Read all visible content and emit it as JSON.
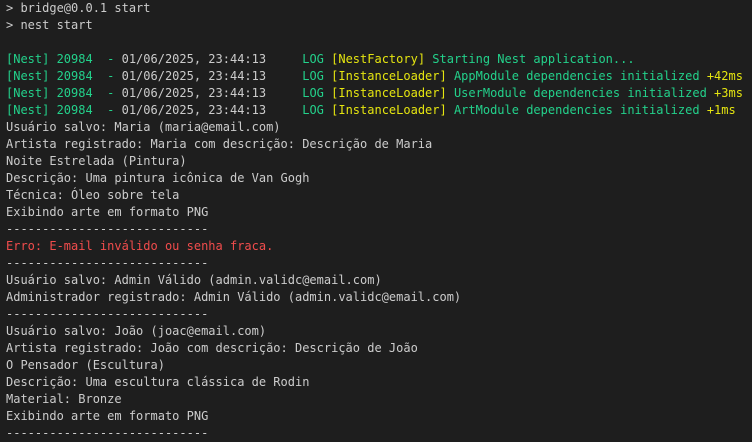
{
  "colors": {
    "background": "#1e1e1e",
    "foreground": "#cccccc",
    "green": "#23d18b",
    "yellow": "#e5e510",
    "red": "#f14c4c"
  },
  "lines": [
    {
      "kind": "plain",
      "text": "> bridge@0.0.1 start"
    },
    {
      "kind": "plain",
      "text": "> nest start"
    },
    {
      "kind": "blank",
      "text": ""
    },
    {
      "kind": "nest",
      "prefix": "[Nest] 20984  - ",
      "timestamp": "01/06/2025, 23:44:13",
      "level": "     LOG ",
      "context": "[NestFactory]",
      "message": " Starting Nest application...",
      "duration": ""
    },
    {
      "kind": "nest",
      "prefix": "[Nest] 20984  - ",
      "timestamp": "01/06/2025, 23:44:13",
      "level": "     LOG ",
      "context": "[InstanceLoader]",
      "message": " AppModule dependencies initialized",
      "duration": " +42ms"
    },
    {
      "kind": "nest",
      "prefix": "[Nest] 20984  - ",
      "timestamp": "01/06/2025, 23:44:13",
      "level": "     LOG ",
      "context": "[InstanceLoader]",
      "message": " UserModule dependencies initialized",
      "duration": " +3ms"
    },
    {
      "kind": "nest",
      "prefix": "[Nest] 20984  - ",
      "timestamp": "01/06/2025, 23:44:13",
      "level": "     LOG ",
      "context": "[InstanceLoader]",
      "message": " ArtModule dependencies initialized",
      "duration": " +1ms"
    },
    {
      "kind": "plain",
      "text": "Usuário salvo: Maria (maria@email.com)"
    },
    {
      "kind": "plain",
      "text": "Artista registrado: Maria com descrição: Descrição de Maria"
    },
    {
      "kind": "plain",
      "text": "Noite Estrelada (Pintura)"
    },
    {
      "kind": "plain",
      "text": "Descrição: Uma pintura icônica de Van Gogh"
    },
    {
      "kind": "plain",
      "text": "Técnica: Óleo sobre tela"
    },
    {
      "kind": "plain",
      "text": "Exibindo arte em formato PNG"
    },
    {
      "kind": "plain",
      "text": "----------------------------"
    },
    {
      "kind": "error",
      "text": "Erro: E-mail inválido ou senha fraca."
    },
    {
      "kind": "plain",
      "text": "----------------------------"
    },
    {
      "kind": "plain",
      "text": "Usuário salvo: Admin Válido (admin.validc@email.com)"
    },
    {
      "kind": "plain",
      "text": "Administrador registrado: Admin Válido (admin.validc@email.com)"
    },
    {
      "kind": "plain",
      "text": "----------------------------"
    },
    {
      "kind": "plain",
      "text": "Usuário salvo: João (joac@email.com)"
    },
    {
      "kind": "plain",
      "text": "Artista registrado: João com descrição: Descrição de João"
    },
    {
      "kind": "plain",
      "text": "O Pensador (Escultura)"
    },
    {
      "kind": "plain",
      "text": "Descrição: Uma escultura clássica de Rodin"
    },
    {
      "kind": "plain",
      "text": "Material: Bronze"
    },
    {
      "kind": "plain",
      "text": "Exibindo arte em formato PNG"
    },
    {
      "kind": "plain",
      "text": "----------------------------"
    }
  ]
}
